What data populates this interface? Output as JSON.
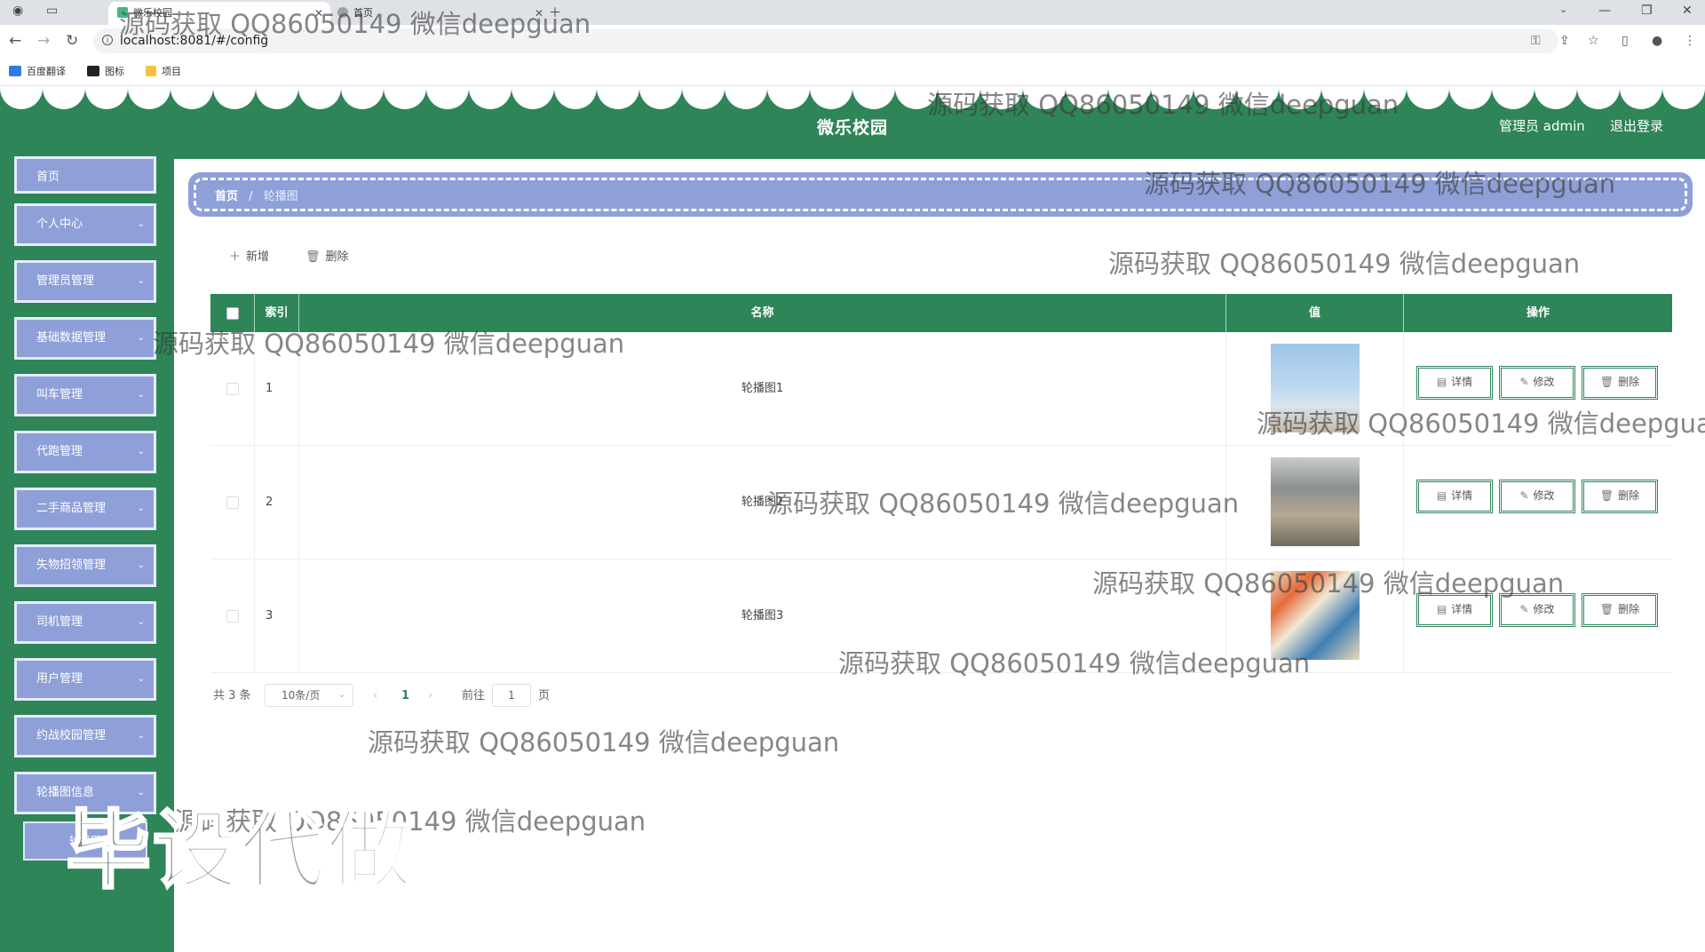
{
  "browser": {
    "tabs": [
      {
        "title": "微乐校园"
      },
      {
        "title": "首页"
      }
    ],
    "url": "localhost:8081/#/config",
    "bookmarks": [
      "百度翻译",
      "图标",
      "项目"
    ]
  },
  "header": {
    "title": "微乐校园",
    "user": "管理员 admin",
    "logout": "退出登录"
  },
  "sidebar": {
    "items": [
      {
        "label": "首页"
      },
      {
        "label": "个人中心"
      },
      {
        "label": "管理员管理"
      },
      {
        "label": "基础数据管理"
      },
      {
        "label": "叫车管理"
      },
      {
        "label": "代跑管理"
      },
      {
        "label": "二手商品管理"
      },
      {
        "label": "失物招领管理"
      },
      {
        "label": "司机管理"
      },
      {
        "label": "用户管理"
      },
      {
        "label": "约战校园管理"
      },
      {
        "label": "轮播图信息"
      }
    ],
    "submenu": {
      "label": "轮播图"
    }
  },
  "breadcrumb": {
    "home": "首页",
    "separator": "/",
    "current": "轮播图"
  },
  "toolbar": {
    "add_label": "新增",
    "delete_label": "删除"
  },
  "table": {
    "headers": {
      "index": "索引",
      "name": "名称",
      "value": "值",
      "action": "操作"
    },
    "rows": [
      {
        "index": "1",
        "name": "轮播图1"
      },
      {
        "index": "2",
        "name": "轮播图2"
      },
      {
        "index": "3",
        "name": "轮播图3"
      }
    ],
    "row_actions": {
      "detail": "详情",
      "edit": "修改",
      "delete": "删除"
    }
  },
  "pagination": {
    "total": "共 3 条",
    "page_size": "10条/页",
    "current_page": "1",
    "goto_label": "前往",
    "goto_value": "1",
    "page_suffix": "页"
  },
  "watermark": {
    "text": "源码获取 QQ86050149 微信deepguan",
    "stamp": "毕设代做"
  },
  "colors": {
    "primary": "#2e8558",
    "menu": "#8fa0d8",
    "menu_border": "#e6ecfb"
  }
}
